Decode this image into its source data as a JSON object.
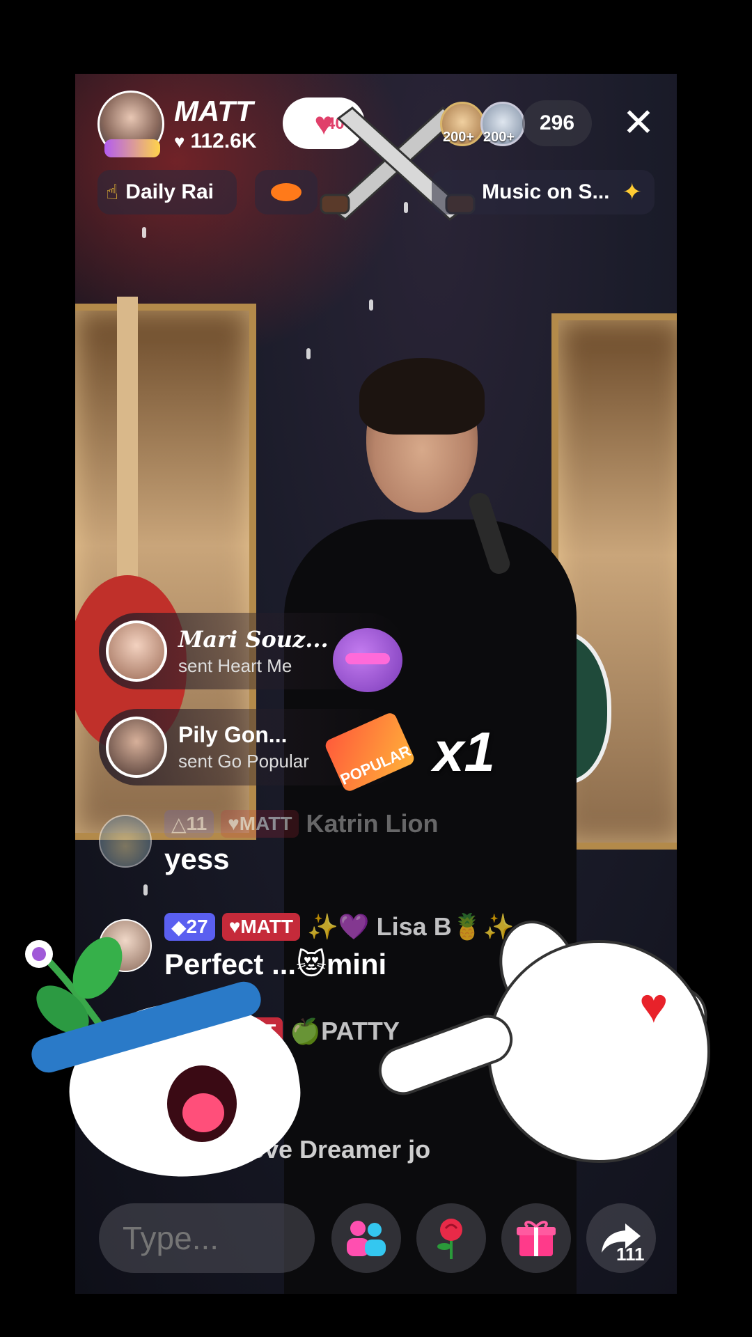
{
  "host": {
    "name": "MATT",
    "likes": "112.6K"
  },
  "header": {
    "follow_count": "40",
    "top_viewers": [
      "200+",
      "200+"
    ],
    "viewer_count": "296",
    "close_icon": "close-icon"
  },
  "promo_bar": {
    "ranking_label": "Daily Rai",
    "music_label": "Music on S..."
  },
  "gifts": [
    {
      "sender": "Mari Souz...",
      "action": "sent Heart Me"
    },
    {
      "sender": "Pily Gon...",
      "action": "sent Go Popular",
      "badge_text": "POPULAR",
      "combo": "x1"
    }
  ],
  "chat": [
    {
      "level": "11",
      "fan_badge": "MATT",
      "user": "Katrin Lion",
      "message": "yess"
    },
    {
      "level": "27",
      "fan_badge": "MATT",
      "user": "✨💜 Lisa B🍍✨",
      "message": "Perfect ...😻mini"
    },
    {
      "fan_badge": "ATT",
      "user": "🍏PATTY"
    },
    {
      "system": "Love Dreamer jo"
    }
  ],
  "bottom_bar": {
    "input_placeholder": "Type...",
    "share_count": "111"
  },
  "colors": {
    "accent_pink": "#e0406a",
    "fan_badge": "#c52a3a",
    "level_badge": "#5a5ff0",
    "gift_box": "#ff3a8a"
  }
}
